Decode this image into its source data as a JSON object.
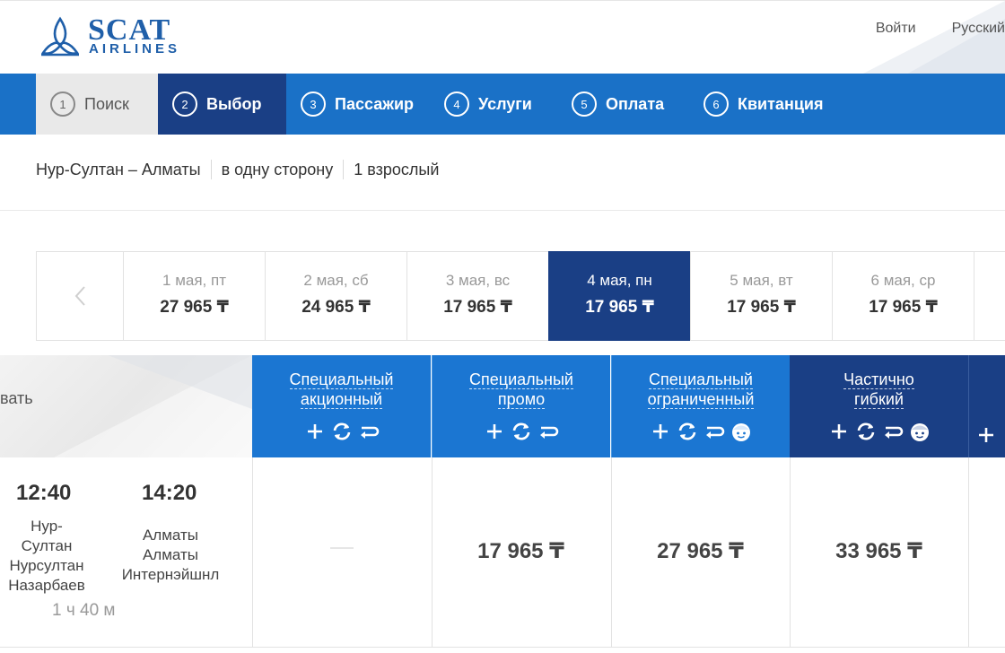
{
  "brand": {
    "name_line1": "SCAT",
    "name_line2": "AIRLINES",
    "primary_color": "#1f5fa9"
  },
  "top_links": {
    "login": "Войти",
    "language": "Русский"
  },
  "steps": [
    {
      "num": "1",
      "label": "Поиск",
      "state": "done"
    },
    {
      "num": "2",
      "label": "Выбор",
      "state": "active"
    },
    {
      "num": "3",
      "label": "Пассажир",
      "state": "todo"
    },
    {
      "num": "4",
      "label": "Услуги",
      "state": "todo"
    },
    {
      "num": "5",
      "label": "Оплата",
      "state": "todo"
    },
    {
      "num": "6",
      "label": "Квитанция",
      "state": "todo"
    }
  ],
  "route": {
    "direction": "Нур-Султан – Алматы",
    "trip_type": "в одну сторону",
    "passengers": "1 взрослый"
  },
  "dates": {
    "prev_icon": "chevron-left-icon",
    "days": [
      {
        "date": "1 мая, пт",
        "price": "27 965 ₸"
      },
      {
        "date": "2 мая, сб",
        "price": "24 965 ₸"
      },
      {
        "date": "3 мая, вс",
        "price": "17 965 ₸"
      },
      {
        "date": "4 мая, пн",
        "price": "17 965 ₸",
        "selected": true
      },
      {
        "date": "5 мая, вт",
        "price": "17 965 ₸"
      },
      {
        "date": "6 мая, ср",
        "price": "17 965 ₸"
      }
    ]
  },
  "grid": {
    "left_header_label": "вать",
    "fares": [
      {
        "line1": "Специальный",
        "line2": "акционный",
        "icons": [
          "plus-icon",
          "exchange-icon",
          "return-icon"
        ]
      },
      {
        "line1": "Специальный",
        "line2": "промо",
        "icons": [
          "plus-icon",
          "exchange-icon",
          "return-icon"
        ]
      },
      {
        "line1": "Специальный",
        "line2": "ограниченный",
        "icons": [
          "plus-icon",
          "exchange-icon",
          "return-icon",
          "child-icon"
        ]
      },
      {
        "line1": "Частично",
        "line2": "гибкий",
        "icons": [
          "plus-icon",
          "exchange-icon",
          "return-icon",
          "child-icon"
        ]
      }
    ],
    "flight": {
      "depart_time": "12:40",
      "arrive_time": "14:20",
      "depart_airport": [
        "Нур-",
        "Султан",
        "Нурсултан",
        "Назарбаев"
      ],
      "arrive_airport": [
        "Алматы",
        "Алматы",
        "Интернэйшнл"
      ],
      "duration": "1 ч 40 м",
      "prices": [
        "",
        "17 965 ₸",
        "27 965 ₸",
        "33 965 ₸"
      ]
    }
  },
  "colors": {
    "step_bar": "#1a71c7",
    "step_active": "#1a3f85",
    "fare_blue": "#1b76d2",
    "fare_dark": "#1a3f85"
  }
}
